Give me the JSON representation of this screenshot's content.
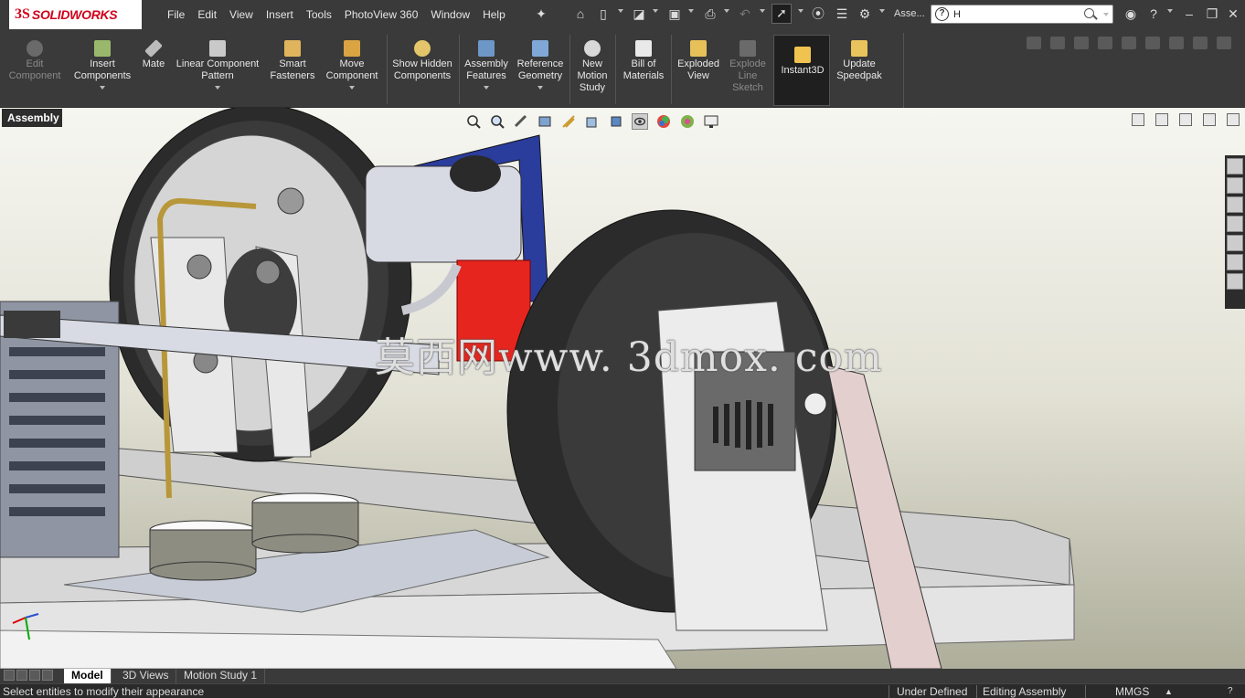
{
  "app": {
    "brand_mark": "3S",
    "brand_name": "SOLIDWORKS"
  },
  "menu": [
    "File",
    "Edit",
    "View",
    "Insert",
    "Tools",
    "PhotoView 360",
    "Window",
    "Help"
  ],
  "search": {
    "context": "Asse...",
    "value": "H"
  },
  "ribbon": {
    "buttons": [
      {
        "label": "Edit Component",
        "enabled": false
      },
      {
        "label": "Insert Components",
        "enabled": true
      },
      {
        "label": "Mate",
        "enabled": true
      },
      {
        "label": "Linear Component Pattern",
        "enabled": true
      },
      {
        "label": "Smart Fasteners",
        "enabled": true
      },
      {
        "label": "Move Component",
        "enabled": true
      },
      {
        "label": "Show Hidden Components",
        "enabled": true
      },
      {
        "label": "Assembly Features",
        "enabled": true
      },
      {
        "label": "Reference Geometry",
        "enabled": true
      },
      {
        "label": "New Motion Study",
        "enabled": true
      },
      {
        "label": "Bill of Materials",
        "enabled": true
      },
      {
        "label": "Exploded View",
        "enabled": true
      },
      {
        "label": "Explode Line Sketch",
        "enabled": false
      },
      {
        "label": "Instant3D",
        "enabled": true,
        "active": true
      },
      {
        "label": "Update Speedpak",
        "enabled": true
      }
    ]
  },
  "feature_tab": "Assembly",
  "watermark": "莫西网www. 3dmox. com",
  "bottom_tabs": [
    {
      "label": "Model",
      "active": true
    },
    {
      "label": "3D Views",
      "active": false
    },
    {
      "label": "Motion Study 1",
      "active": false
    }
  ],
  "status": {
    "message": "Select entities to modify their appearance",
    "definition": "Under Defined",
    "mode": "Editing Assembly",
    "units": "MMGS"
  },
  "colors": {
    "accent": "#d0021b",
    "ui_dark": "#3a3a3a",
    "active_tab": "#1f1f1f"
  }
}
